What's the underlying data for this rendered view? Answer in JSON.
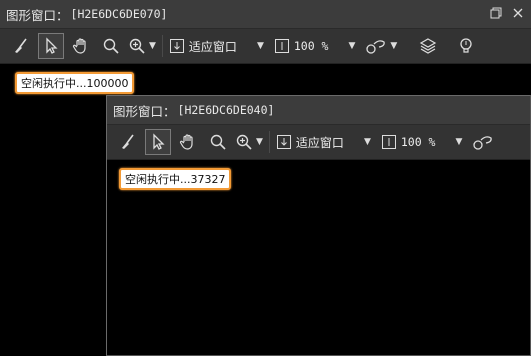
{
  "window1": {
    "title_label": "图形窗口：",
    "title_id": "[H2E6DC6DE070]",
    "zoom_mode": "适应窗口",
    "zoom_level": "100 %",
    "status_badge": "空闲执行中...100000"
  },
  "window2": {
    "title_label": "图形窗口：",
    "title_id": "[H2E6DC6DE040]",
    "zoom_mode": "适应窗口",
    "zoom_level": "100 %",
    "status_badge": "空闲执行中...37327"
  },
  "icons": {
    "clear": "broom-icon",
    "select": "pointer-icon",
    "pan": "hand-icon",
    "zoom": "magnifier-icon",
    "zoom_in": "zoom-in-icon",
    "fit": "fit-window-icon",
    "actual": "actual-size-icon",
    "shape": "shape-icon",
    "layers": "layers-icon",
    "light": "lightbulb-icon"
  },
  "colors": {
    "badge_border": "#f39a35",
    "canvas": "#000000",
    "chrome": "#3a3a3a"
  }
}
